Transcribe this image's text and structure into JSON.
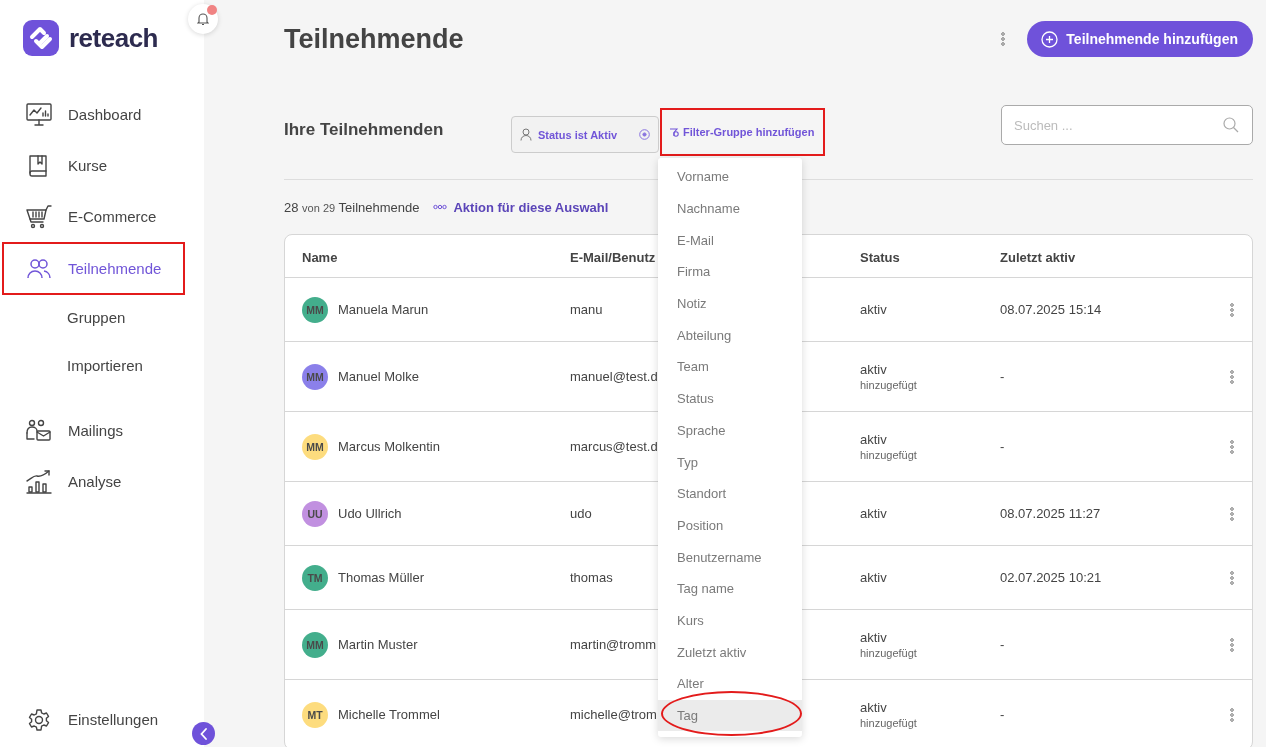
{
  "sidebar": {
    "brand": "reteach",
    "notifications": {
      "unread": true
    },
    "items": [
      {
        "label": "Dashboard",
        "selected": false,
        "framed": false
      },
      {
        "label": "Kurse",
        "selected": false,
        "framed": false
      },
      {
        "label": "E-Commerce",
        "selected": false,
        "framed": false
      },
      {
        "label": "Teilnehmende",
        "selected": true,
        "framed": true,
        "children": [
          {
            "label": "Gruppen",
            "selected": false
          },
          {
            "label": "Importieren",
            "selected": false
          }
        ]
      },
      {
        "label": "Mailings",
        "selected": false,
        "framed": false
      },
      {
        "label": "Analyse",
        "selected": false,
        "framed": false
      }
    ],
    "footer": {
      "label": "Einstellungen"
    }
  },
  "header": {
    "title": "Teilnehmende",
    "add_button": "Teilnehmende hinzufügen"
  },
  "filters": {
    "title": "Ihre Teilnehmenden",
    "chip": "Status ist Aktiv",
    "add_group": {
      "label": "Filter-Gruppe hinzufügen",
      "framed": true
    },
    "search": {
      "placeholder": "Suchen ..."
    }
  },
  "summary": {
    "count": "28",
    "of": "von 29",
    "label": "Teilnehmende",
    "action": "Aktion für diese Auswahl"
  },
  "table": {
    "columns": [
      "Name",
      "E-Mail/Benutz",
      "Status",
      "Zuletzt aktiv"
    ],
    "rows": [
      {
        "initials": "MM",
        "color": "#43ae8c",
        "name": "Manuela Marun",
        "email": "manu",
        "status": "aktiv",
        "last_active": "08.07.2025 15:14"
      },
      {
        "initials": "MM",
        "color": "#8b80ea",
        "name": "Manuel Molke",
        "email": "manuel@test.d",
        "status": "aktiv",
        "note": "hinzugefügt",
        "last_active": "-"
      },
      {
        "initials": "MM",
        "color": "#fddc7e",
        "name": "Marcus Molkentin",
        "email": "marcus@test.d",
        "status": "aktiv",
        "note": "hinzugefügt",
        "last_active": "-"
      },
      {
        "initials": "UU",
        "color": "#c190e0",
        "name": "Udo Ullrich",
        "email": "udo",
        "status": "aktiv",
        "last_active": "08.07.2025 11:27"
      },
      {
        "initials": "TM",
        "color": "#43ae8c",
        "name": "Thomas Müller",
        "email": "thomas",
        "status": "aktiv",
        "last_active": "02.07.2025 10:21"
      },
      {
        "initials": "MM",
        "color": "#43ae8c",
        "name": "Martin Muster",
        "email": "martin@tromm",
        "status": "aktiv",
        "note": "hinzugefügt",
        "last_active": "-"
      },
      {
        "initials": "MT",
        "color": "#fddc7e",
        "name": "Michelle Trommel",
        "email": "michelle@trom",
        "status": "aktiv",
        "note": "hinzugefügt",
        "last_active": "-"
      }
    ]
  },
  "dropdown": {
    "items": [
      {
        "label": "Vorname",
        "highlighted": false,
        "circled": false
      },
      {
        "label": "Nachname",
        "highlighted": false,
        "circled": false
      },
      {
        "label": "E-Mail",
        "highlighted": false,
        "circled": false
      },
      {
        "label": "Firma",
        "highlighted": false,
        "circled": false
      },
      {
        "label": "Notiz",
        "highlighted": false,
        "circled": false
      },
      {
        "label": "Abteilung",
        "highlighted": false,
        "circled": false
      },
      {
        "label": "Team",
        "highlighted": false,
        "circled": false
      },
      {
        "label": "Status",
        "highlighted": false,
        "circled": false
      },
      {
        "label": "Sprache",
        "highlighted": false,
        "circled": false
      },
      {
        "label": "Typ",
        "highlighted": false,
        "circled": false
      },
      {
        "label": "Standort",
        "highlighted": false,
        "circled": false
      },
      {
        "label": "Position",
        "highlighted": false,
        "circled": false
      },
      {
        "label": "Benutzername",
        "highlighted": false,
        "circled": false
      },
      {
        "label": "Tag name",
        "highlighted": false,
        "circled": false
      },
      {
        "label": "Kurs",
        "highlighted": false,
        "circled": false
      },
      {
        "label": "Zuletzt aktiv",
        "highlighted": false,
        "circled": false
      },
      {
        "label": "Alter",
        "highlighted": false,
        "circled": false
      },
      {
        "label": "Tag",
        "highlighted": true,
        "circled": true
      }
    ]
  }
}
